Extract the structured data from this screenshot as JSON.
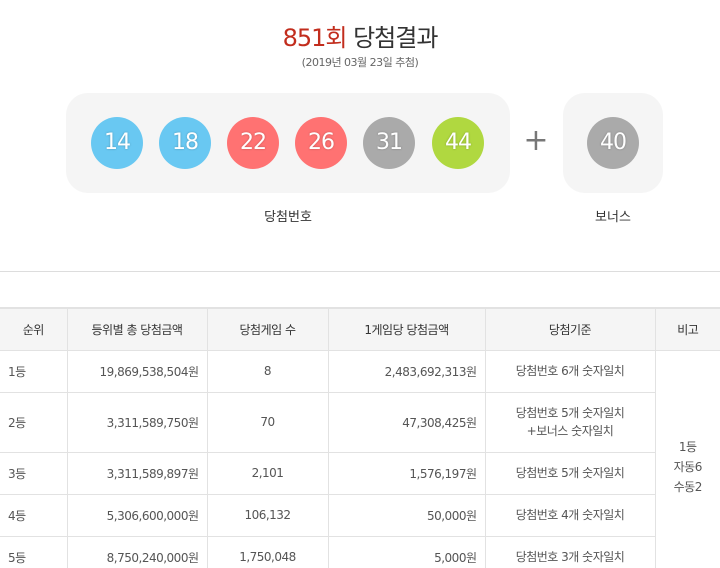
{
  "header": {
    "round": "851회",
    "label": "당첨결과",
    "date": "(2019년 03월 23일 추첨)"
  },
  "winning": {
    "numbers": [
      "14",
      "18",
      "22",
      "26",
      "31",
      "44"
    ],
    "bonus": "40",
    "plus": "+",
    "label": "당첨번호",
    "bonus_label": "보너스",
    "colors": [
      "#69c8f2",
      "#69c8f2",
      "#ff7272",
      "#ff7272",
      "#aaaaaa",
      "#b0d840"
    ],
    "bonus_color": "#aaaaaa"
  },
  "table": {
    "headers": [
      "순위",
      "등위별 총 당첨금액",
      "당첨게임 수",
      "1게임당 당첨금액",
      "당첨기준",
      "비고"
    ],
    "rows": [
      {
        "rank": "1등",
        "total": "19,869,538,504원",
        "count": "8",
        "per": "2,483,692,313원",
        "criteria": [
          "당첨번호 6개 숫자일치"
        ]
      },
      {
        "rank": "2등",
        "total": "3,311,589,750원",
        "count": "70",
        "per": "47,308,425원",
        "criteria": [
          "당첨번호 5개 숫자일치",
          "+보너스 숫자일치"
        ]
      },
      {
        "rank": "3등",
        "total": "3,311,589,897원",
        "count": "2,101",
        "per": "1,576,197원",
        "criteria": [
          "당첨번호 5개 숫자일치"
        ]
      },
      {
        "rank": "4등",
        "total": "5,306,600,000원",
        "count": "106,132",
        "per": "50,000원",
        "criteria": [
          "당첨번호 4개 숫자일치"
        ]
      },
      {
        "rank": "5등",
        "total": "8,750,240,000원",
        "count": "1,750,048",
        "per": "5,000원",
        "criteria": [
          "당첨번호 3개 숫자일치"
        ]
      }
    ],
    "note": [
      "1등",
      "자동6",
      "수동2"
    ]
  }
}
